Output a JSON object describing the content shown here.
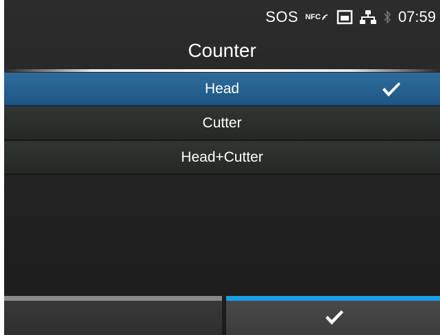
{
  "status": {
    "sos": "SOS",
    "nfc": "NFC",
    "time": "07:59",
    "icons": [
      "nfc-icon",
      "sd-card-icon",
      "network-icon",
      "bluetooth-icon"
    ]
  },
  "title": "Counter",
  "options": [
    {
      "label": "Head",
      "selected": true
    },
    {
      "label": "Cutter",
      "selected": false
    },
    {
      "label": "Head+Cutter",
      "selected": false
    }
  ],
  "buttons": {
    "left": "back",
    "right": "confirm-check"
  },
  "colors": {
    "selected_row": "#25608f",
    "confirm_bar": "#1aa0e6",
    "back_bar": "#8a8a8a"
  }
}
